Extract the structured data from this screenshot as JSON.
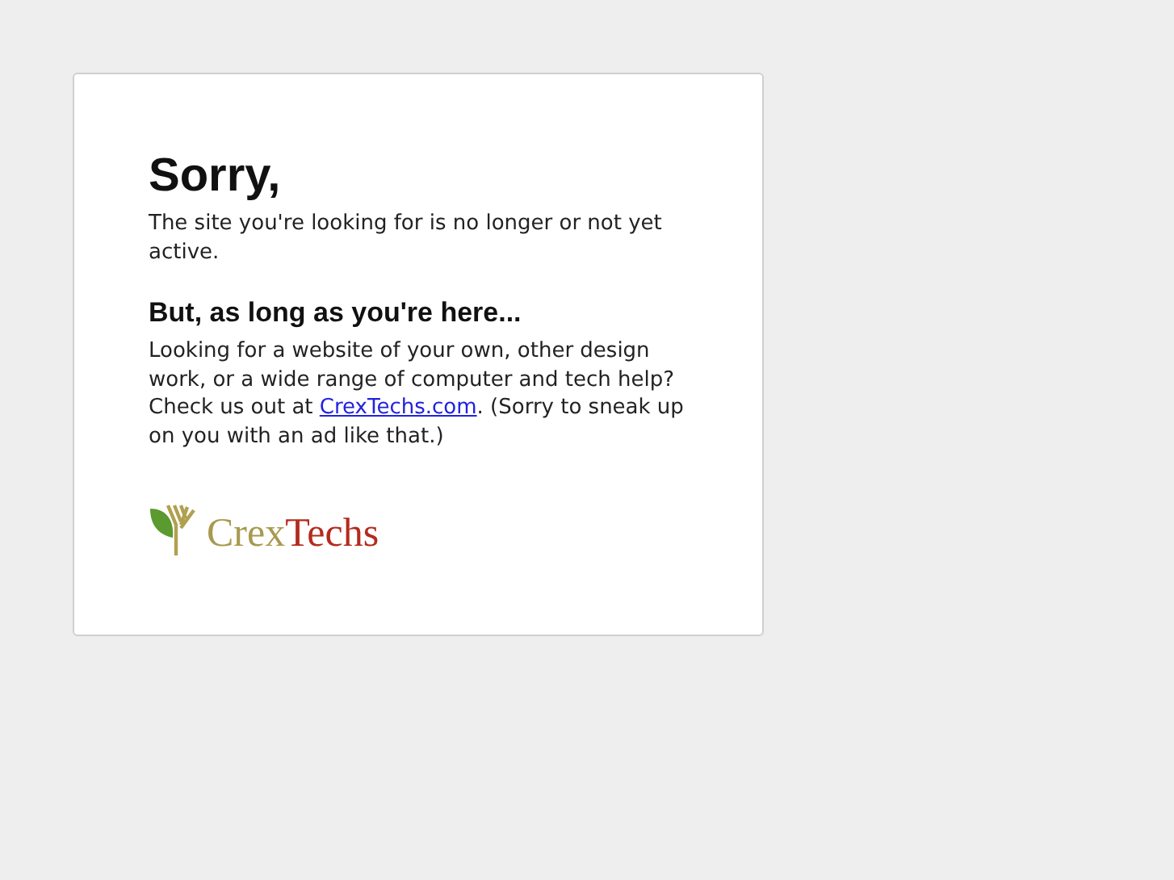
{
  "heading": "Sorry,",
  "intro": "The site you're looking for is no longer or not yet active.",
  "subheading": "But, as long as you're here...",
  "pitch": {
    "before": "Looking for a website of your own, other design work, or a wide range of computer and tech help? Check us out at ",
    "link": "CrexTechs.com",
    "after": ". (Sorry to sneak up on you with an ad like that.)"
  },
  "logo": {
    "parts": [
      {
        "text": "Crex",
        "color": "#a89a4e"
      },
      {
        "text": "Techs",
        "color": "#b42a1e"
      }
    ]
  }
}
